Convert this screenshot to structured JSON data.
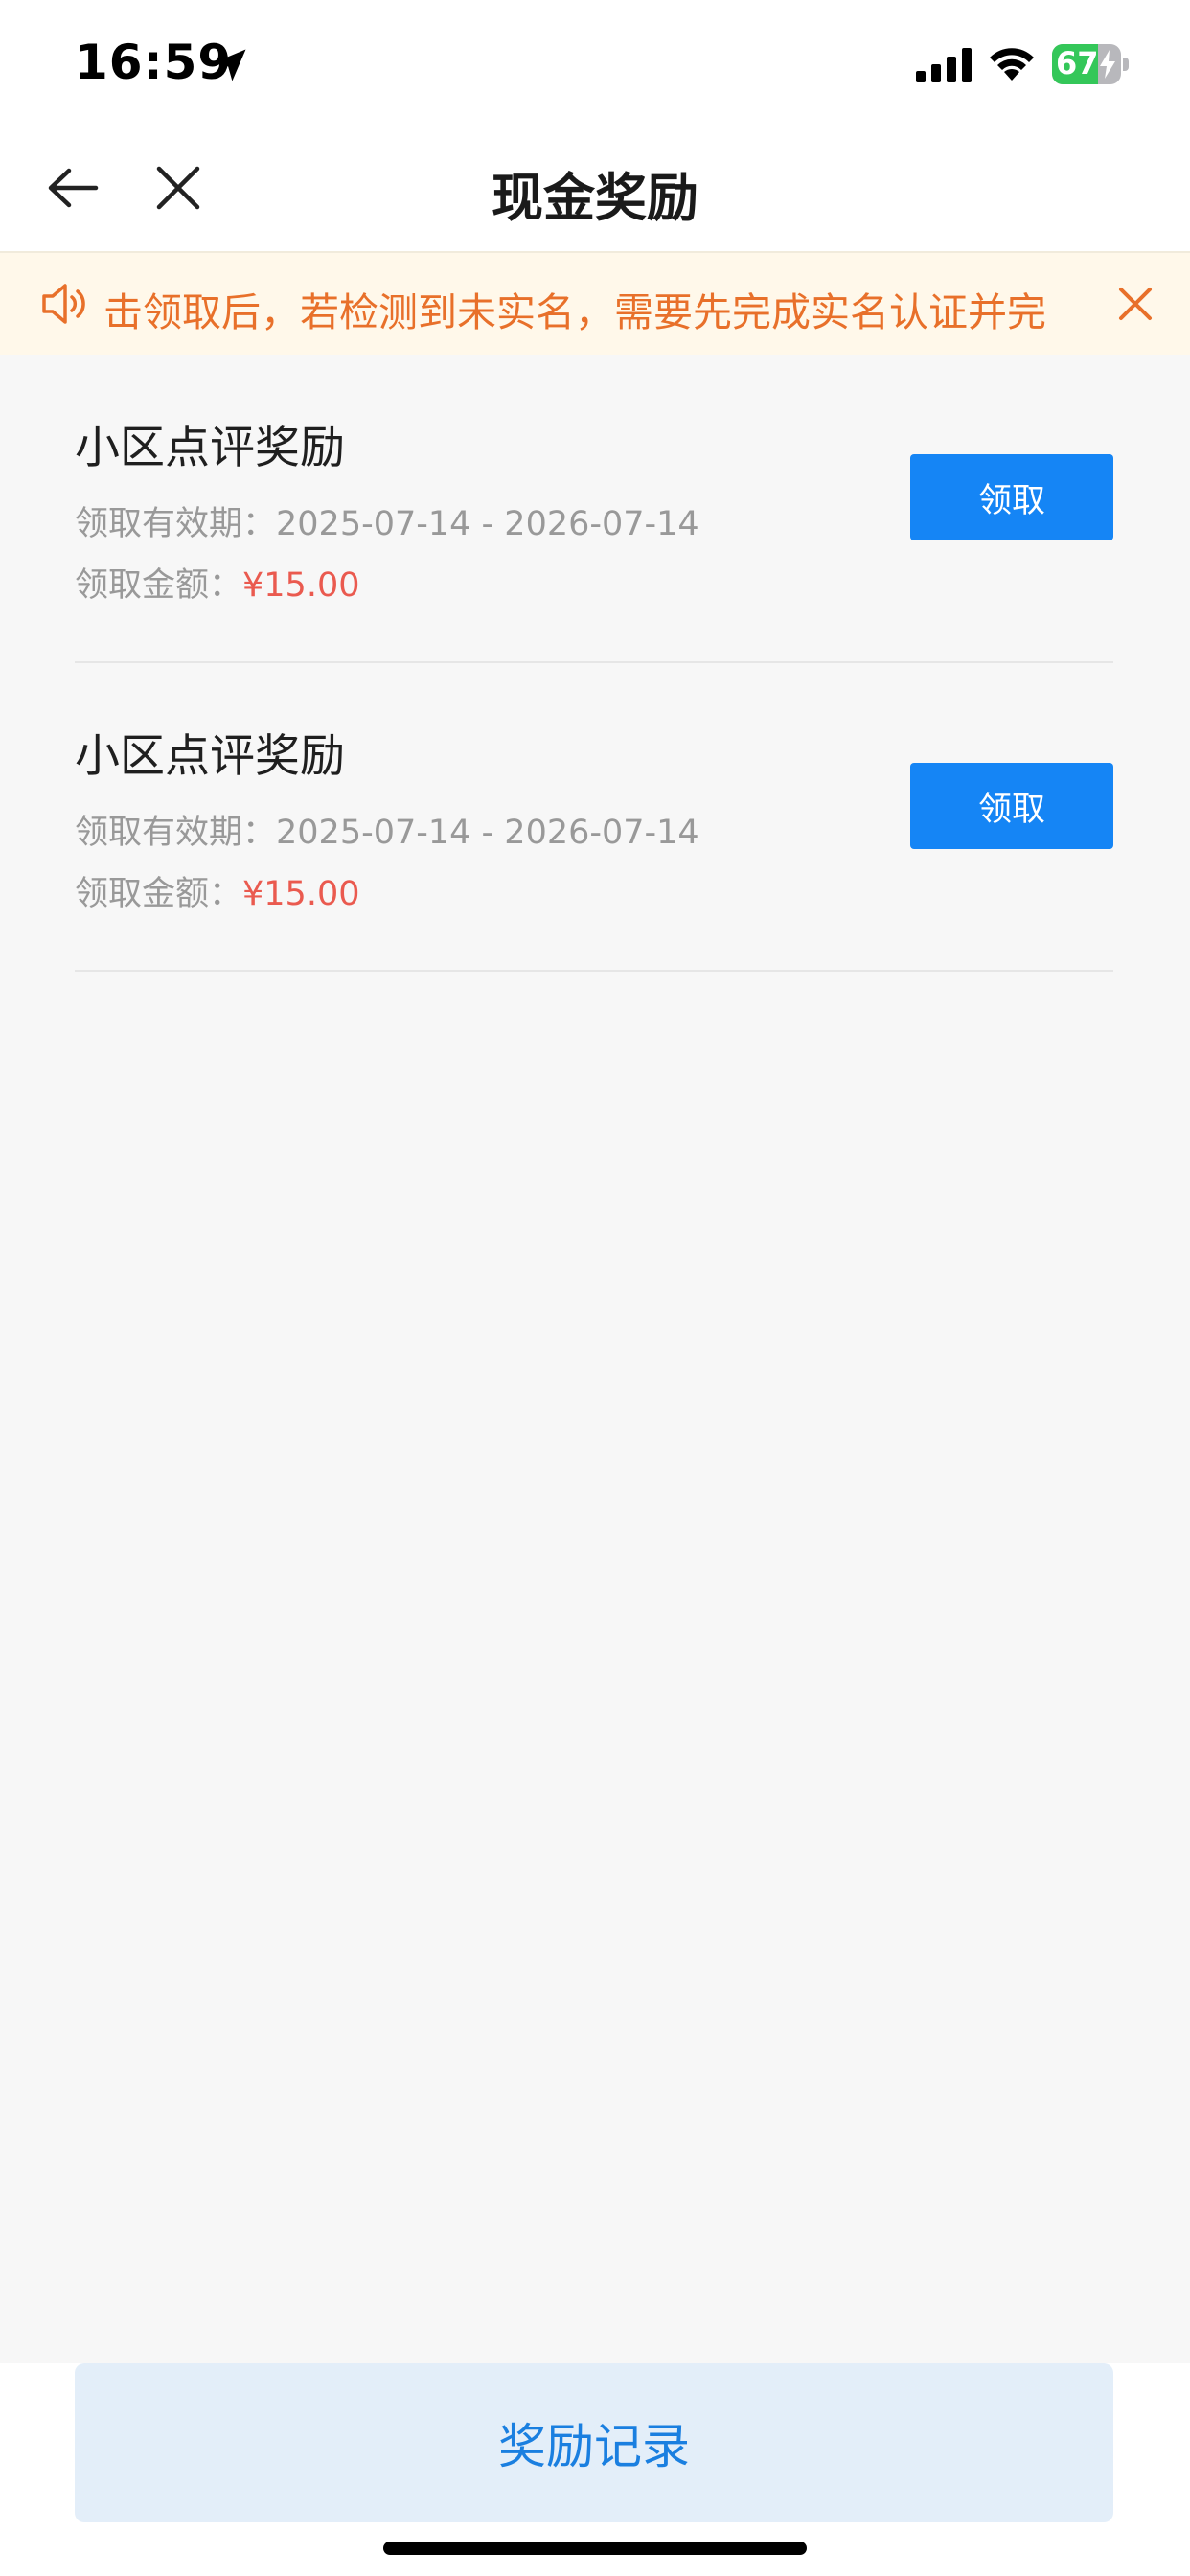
{
  "status_bar": {
    "time": "16:59",
    "battery_level": "67",
    "battery_fraction": 0.67
  },
  "nav": {
    "title": "现金奖励"
  },
  "notice": {
    "text": "击领取后，若检测到未实名，需要先完成实名认证并完"
  },
  "rewards": [
    {
      "title": "小区点评奖励",
      "validity_label": "领取有效期：",
      "validity_value": "2025-07-14 - 2026-07-14",
      "amount_label": "领取金额：",
      "amount_value": "¥15.00",
      "button_label": "领取"
    },
    {
      "title": "小区点评奖励",
      "validity_label": "领取有效期：",
      "validity_value": "2025-07-14 - 2026-07-14",
      "amount_label": "领取金额：",
      "amount_value": "¥15.00",
      "button_label": "领取"
    }
  ],
  "bottom": {
    "records_label": "奖励记录"
  },
  "colors": {
    "accent_blue": "#1585f5",
    "notice_orange": "#e8702a",
    "amount_red": "#ea5a4f",
    "battery_green": "#34c759"
  }
}
